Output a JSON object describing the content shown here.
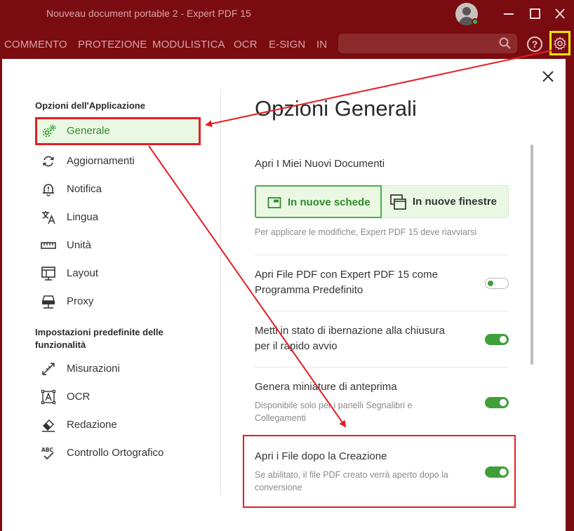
{
  "window": {
    "title": "Nouveau document portable 2   -   Expert PDF 15",
    "minimize_icon": "minimize-icon",
    "maximize_icon": "maximize-icon",
    "close_icon": "close-icon"
  },
  "menubar": {
    "items": [
      "COMMENTO",
      "PROTEZIONE",
      "MODULISTICA",
      "OCR",
      "E-SIGN",
      "IN"
    ],
    "search_placeholder": "",
    "help_label": "?"
  },
  "sidebar": {
    "section1_title": "Opzioni dell'Applicazione",
    "items": [
      {
        "label": "Generale",
        "icon": "gears-icon",
        "active": true
      },
      {
        "label": "Aggiornamenti",
        "icon": "refresh-icon",
        "active": false
      },
      {
        "label": "Notifica",
        "icon": "bell-icon",
        "active": false
      },
      {
        "label": "Lingua",
        "icon": "translate-icon",
        "active": false
      },
      {
        "label": "Unità",
        "icon": "ruler-icon",
        "active": false
      },
      {
        "label": "Layout",
        "icon": "layout-icon",
        "active": false
      },
      {
        "label": "Proxy",
        "icon": "proxy-icon",
        "active": false
      }
    ],
    "section2_title": "Impostazioni predefinite delle funzionalità",
    "items2": [
      {
        "label": "Misurazioni",
        "icon": "measure-icon"
      },
      {
        "label": "OCR",
        "icon": "ocr-icon"
      },
      {
        "label": "Redazione",
        "icon": "eraser-icon"
      },
      {
        "label": "Controllo Ortografico",
        "icon": "spellcheck-icon"
      }
    ]
  },
  "main": {
    "heading": "Opzioni Generali",
    "open_docs_label": "Apri I Miei Nuovi Documenti",
    "option_tabs": "In nuove schede",
    "option_windows": "In nuove finestre",
    "restart_note": "Per applicare le modifiche, Expert PDF 15 deve riavviarsi",
    "settings": [
      {
        "title": "Apri File PDF con Expert PDF 15 come Programma Predefinito",
        "desc": "",
        "on": false
      },
      {
        "title": "Metti in stato di ibernazione alla chiusura per il rapido avvio",
        "desc": "",
        "on": true
      },
      {
        "title": "Genera miniature di anteprima",
        "desc": "Disponibile solo per i panelli Segnalibri e Collegamenti",
        "on": true
      },
      {
        "title": "Apri i File dopo la Creazione",
        "desc": "Se abilitato, il file PDF creato verrà aperto dopo la conversione",
        "on": true
      }
    ]
  },
  "colors": {
    "brand": "#7a0c11",
    "accent_green": "#3f9f3a",
    "highlight_red": "#e31e24",
    "highlight_yellow": "#f5e400"
  }
}
